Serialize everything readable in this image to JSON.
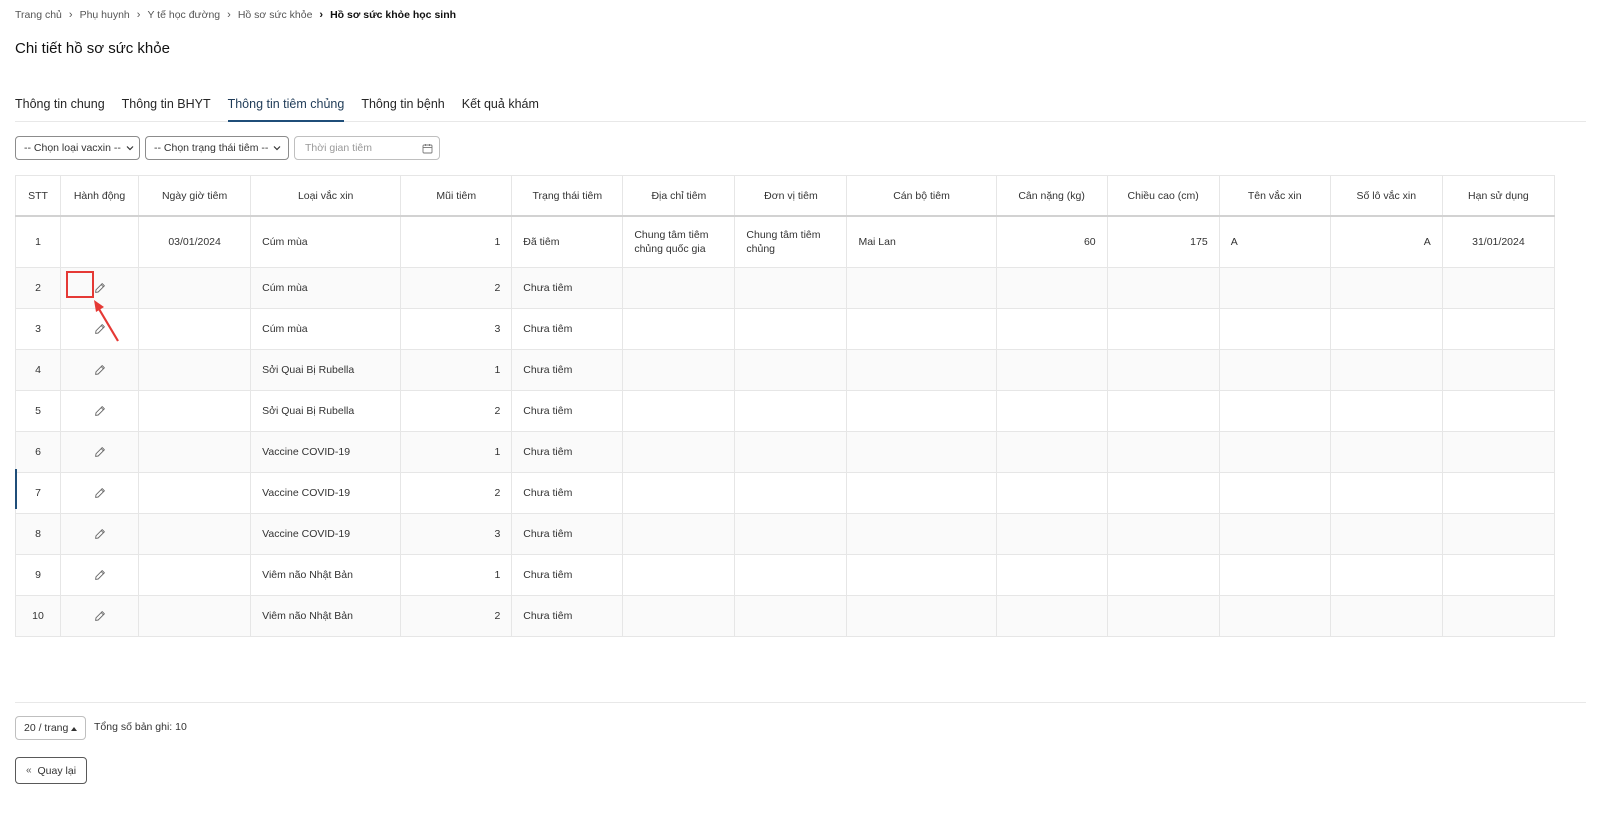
{
  "breadcrumb": {
    "items": [
      "Trang chủ",
      "Phụ huynh",
      "Y tế học đường",
      "Hồ sơ sức khỏe"
    ],
    "current": "Hồ sơ sức khỏe học sinh"
  },
  "page_title": "Chi tiết hồ sơ sức khỏe",
  "tabs": [
    {
      "label": "Thông tin chung",
      "active": false
    },
    {
      "label": "Thông tin BHYT",
      "active": false
    },
    {
      "label": "Thông tin tiêm chủng",
      "active": true
    },
    {
      "label": "Thông tin bệnh",
      "active": false
    },
    {
      "label": "Kết quả khám",
      "active": false
    }
  ],
  "filters": {
    "vaccine_type": "-- Chọn loại vacxin --",
    "status": "-- Chọn trạng thái tiêm --",
    "date_placeholder": "Thời gian tiêm"
  },
  "table": {
    "headers": [
      "STT",
      "Hành động",
      "Ngày giờ tiêm",
      "Loại vắc xin",
      "Mũi tiêm",
      "Trạng thái tiêm",
      "Địa chỉ tiêm",
      "Đơn vị tiêm",
      "Cán bộ tiêm",
      "Cân nặng (kg)",
      "Chiều cao (cm)",
      "Tên vắc xin",
      "Số lô vắc xin",
      "Hạn sử dụng"
    ],
    "rows": [
      {
        "stt": "1",
        "editable": false,
        "date": "03/01/2024",
        "vaccine": "Cúm mùa",
        "dose": "1",
        "status": "Đã tiêm",
        "address": "Chung tâm tiêm chủng quốc gia",
        "unit": "Chung tâm tiêm chủng",
        "staff": "Mai Lan",
        "weight": "60",
        "height": "175",
        "name": "A",
        "lot": "A",
        "expiry": "31/01/2024"
      },
      {
        "stt": "2",
        "editable": true,
        "date": "",
        "vaccine": "Cúm mùa",
        "dose": "2",
        "status": "Chưa tiêm",
        "address": "",
        "unit": "",
        "staff": "",
        "weight": "",
        "height": "",
        "name": "",
        "lot": "",
        "expiry": ""
      },
      {
        "stt": "3",
        "editable": true,
        "date": "",
        "vaccine": "Cúm mùa",
        "dose": "3",
        "status": "Chưa tiêm",
        "address": "",
        "unit": "",
        "staff": "",
        "weight": "",
        "height": "",
        "name": "",
        "lot": "",
        "expiry": ""
      },
      {
        "stt": "4",
        "editable": true,
        "date": "",
        "vaccine": "Sởi Quai Bị Rubella",
        "dose": "1",
        "status": "Chưa tiêm",
        "address": "",
        "unit": "",
        "staff": "",
        "weight": "",
        "height": "",
        "name": "",
        "lot": "",
        "expiry": ""
      },
      {
        "stt": "5",
        "editable": true,
        "date": "",
        "vaccine": "Sởi Quai Bị Rubella",
        "dose": "2",
        "status": "Chưa tiêm",
        "address": "",
        "unit": "",
        "staff": "",
        "weight": "",
        "height": "",
        "name": "",
        "lot": "",
        "expiry": ""
      },
      {
        "stt": "6",
        "editable": true,
        "date": "",
        "vaccine": "Vaccine COVID-19",
        "dose": "1",
        "status": "Chưa tiêm",
        "address": "",
        "unit": "",
        "staff": "",
        "weight": "",
        "height": "",
        "name": "",
        "lot": "",
        "expiry": ""
      },
      {
        "stt": "7",
        "editable": true,
        "date": "",
        "vaccine": "Vaccine COVID-19",
        "dose": "2",
        "status": "Chưa tiêm",
        "address": "",
        "unit": "",
        "staff": "",
        "weight": "",
        "height": "",
        "name": "",
        "lot": "",
        "expiry": ""
      },
      {
        "stt": "8",
        "editable": true,
        "date": "",
        "vaccine": "Vaccine COVID-19",
        "dose": "3",
        "status": "Chưa tiêm",
        "address": "",
        "unit": "",
        "staff": "",
        "weight": "",
        "height": "",
        "name": "",
        "lot": "",
        "expiry": ""
      },
      {
        "stt": "9",
        "editable": true,
        "date": "",
        "vaccine": "Viêm não Nhật Bản",
        "dose": "1",
        "status": "Chưa tiêm",
        "address": "",
        "unit": "",
        "staff": "",
        "weight": "",
        "height": "",
        "name": "",
        "lot": "",
        "expiry": ""
      },
      {
        "stt": "10",
        "editable": true,
        "date": "",
        "vaccine": "Viêm não Nhật Bản",
        "dose": "2",
        "status": "Chưa tiêm",
        "address": "",
        "unit": "",
        "staff": "",
        "weight": "",
        "height": "",
        "name": "",
        "lot": "",
        "expiry": ""
      }
    ]
  },
  "pagination": {
    "page_size": "20 / trang",
    "total": "Tổng số bản ghi: 10"
  },
  "back_button": "Quay lại",
  "icons": {
    "edit": "pencil-icon",
    "calendar": "calendar-icon",
    "chevron": "chevron-down-icon",
    "back": "double-chevron-left-icon"
  },
  "colors": {
    "accent": "#1f4e79",
    "annotation": "#e53935"
  }
}
